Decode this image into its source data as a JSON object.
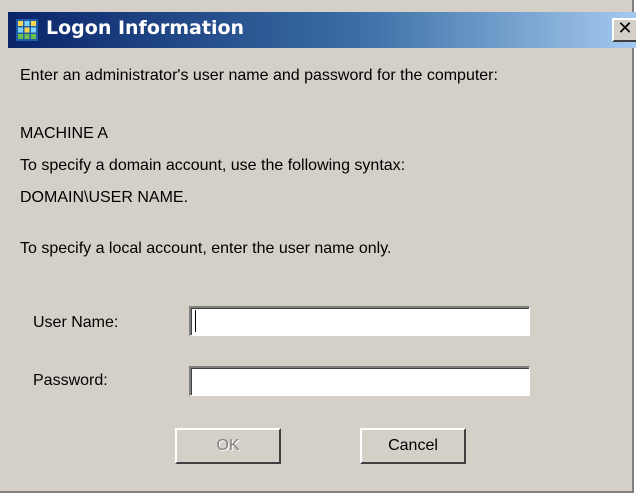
{
  "window": {
    "title": "Logon Information",
    "close_symbol": "✕"
  },
  "content": {
    "intro": "Enter an administrator's user name and password for the computer:",
    "machine": "MACHINE A",
    "domain_hint": "To specify a domain account, use the following syntax:",
    "domain_syntax": "DOMAIN\\USER NAME.",
    "local_hint": "To specify a local account, enter the user name only."
  },
  "form": {
    "username_label": "User Name:",
    "username_value": "",
    "password_label": "Password:",
    "password_value": ""
  },
  "buttons": {
    "ok_label": "OK",
    "cancel_label": "Cancel"
  },
  "colors": {
    "face": "#d4d0c8",
    "title_start": "#0a246a",
    "title_end": "#a6caf0"
  },
  "icons": {
    "title_icon": "app-grid-icon",
    "close_icon": "close-icon"
  }
}
